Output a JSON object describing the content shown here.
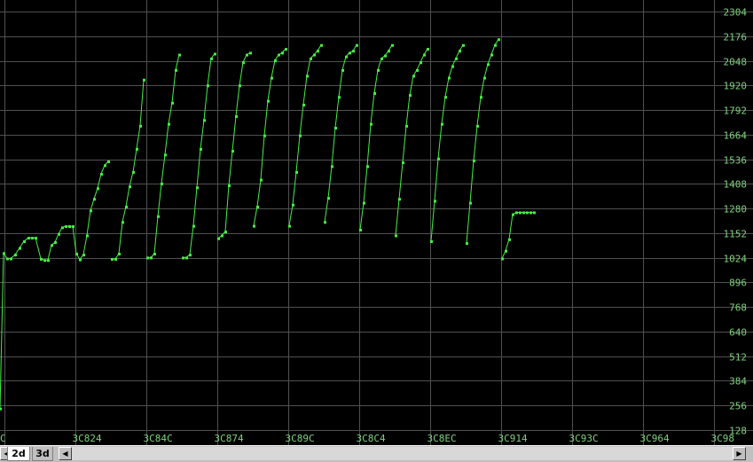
{
  "chart_data": {
    "type": "line",
    "title": "",
    "xlabel": "",
    "ylabel": "",
    "x_tick_labels": [
      "C",
      "3C824",
      "3C84C",
      "3C874",
      "3C89C",
      "3C8C4",
      "3C8EC",
      "3C914",
      "3C93C",
      "3C964",
      "3C98"
    ],
    "y_ticks": [
      128,
      256,
      384,
      512,
      640,
      768,
      896,
      1024,
      1152,
      1280,
      1408,
      1536,
      1664,
      1792,
      1920,
      2048,
      2176,
      2304
    ],
    "ylim": [
      128,
      2304
    ],
    "x_index_range": [
      0,
      849
    ],
    "grid": true,
    "line_color": "#44ee44",
    "background": "#000000",
    "series": [
      {
        "values": [
          [
            0,
            240
          ],
          [
            4,
            1048
          ],
          [
            8,
            1020
          ],
          [
            12,
            1020
          ],
          [
            17,
            1040
          ],
          [
            22,
            1075
          ],
          [
            27,
            1110
          ],
          [
            32,
            1128
          ],
          [
            36,
            1128
          ],
          [
            40,
            1128
          ],
          [
            46,
            1018
          ],
          [
            50,
            1012
          ],
          [
            54,
            1012
          ],
          [
            58,
            1090
          ],
          [
            62,
            1105
          ],
          [
            66,
            1148
          ],
          [
            70,
            1182
          ],
          [
            74,
            1188
          ],
          [
            78,
            1188
          ],
          [
            82,
            1188
          ],
          [
            86,
            1045
          ],
          [
            90,
            1015
          ],
          [
            94,
            1040
          ],
          [
            98,
            1140
          ],
          [
            102,
            1270
          ],
          [
            106,
            1330
          ],
          [
            110,
            1385
          ],
          [
            114,
            1460
          ],
          [
            118,
            1505
          ],
          [
            122,
            1525
          ],
          [
            126,
            1018
          ],
          [
            130,
            1018
          ],
          [
            134,
            1045
          ],
          [
            138,
            1210
          ],
          [
            142,
            1290
          ],
          [
            146,
            1395
          ],
          [
            150,
            1470
          ],
          [
            154,
            1590
          ],
          [
            158,
            1710
          ],
          [
            162,
            1950
          ],
          [
            166,
            1025
          ],
          [
            170,
            1025
          ],
          [
            174,
            1045
          ],
          [
            178,
            1240
          ],
          [
            182,
            1410
          ],
          [
            186,
            1560
          ],
          [
            190,
            1720
          ],
          [
            194,
            1830
          ],
          [
            198,
            2000
          ],
          [
            202,
            2080
          ],
          [
            206,
            1025
          ],
          [
            210,
            1025
          ],
          [
            214,
            1040
          ],
          [
            218,
            1190
          ],
          [
            222,
            1390
          ],
          [
            226,
            1590
          ],
          [
            230,
            1740
          ],
          [
            234,
            1920
          ],
          [
            238,
            2060
          ],
          [
            242,
            2085
          ],
          [
            246,
            1125
          ],
          [
            250,
            1140
          ],
          [
            254,
            1160
          ],
          [
            258,
            1400
          ],
          [
            262,
            1580
          ],
          [
            266,
            1760
          ],
          [
            270,
            1920
          ],
          [
            274,
            2040
          ],
          [
            278,
            2080
          ],
          [
            282,
            2090
          ],
          [
            286,
            1190
          ],
          [
            290,
            1290
          ],
          [
            294,
            1430
          ],
          [
            298,
            1660
          ],
          [
            302,
            1840
          ],
          [
            306,
            1960
          ],
          [
            310,
            2050
          ],
          [
            314,
            2080
          ],
          [
            318,
            2090
          ],
          [
            322,
            2110
          ],
          [
            326,
            1190
          ],
          [
            330,
            1300
          ],
          [
            334,
            1470
          ],
          [
            338,
            1660
          ],
          [
            342,
            1820
          ],
          [
            346,
            1970
          ],
          [
            350,
            2060
          ],
          [
            354,
            2080
          ],
          [
            358,
            2100
          ],
          [
            362,
            2130
          ],
          [
            366,
            1210
          ],
          [
            370,
            1335
          ],
          [
            374,
            1500
          ],
          [
            378,
            1700
          ],
          [
            382,
            1860
          ],
          [
            386,
            2000
          ],
          [
            390,
            2070
          ],
          [
            394,
            2090
          ],
          [
            398,
            2100
          ],
          [
            402,
            2130
          ],
          [
            406,
            1170
          ],
          [
            410,
            1310
          ],
          [
            414,
            1500
          ],
          [
            418,
            1720
          ],
          [
            422,
            1880
          ],
          [
            426,
            2000
          ],
          [
            430,
            2060
          ],
          [
            434,
            2075
          ],
          [
            438,
            2100
          ],
          [
            442,
            2130
          ],
          [
            446,
            1140
          ],
          [
            450,
            1330
          ],
          [
            454,
            1520
          ],
          [
            458,
            1710
          ],
          [
            462,
            1870
          ],
          [
            466,
            1970
          ],
          [
            470,
            2000
          ],
          [
            474,
            2040
          ],
          [
            478,
            2080
          ],
          [
            482,
            2110
          ],
          [
            486,
            1110
          ],
          [
            490,
            1320
          ],
          [
            494,
            1540
          ],
          [
            498,
            1720
          ],
          [
            502,
            1860
          ],
          [
            506,
            1960
          ],
          [
            510,
            2020
          ],
          [
            514,
            2060
          ],
          [
            518,
            2100
          ],
          [
            522,
            2130
          ],
          [
            526,
            1100
          ],
          [
            530,
            1310
          ],
          [
            534,
            1530
          ],
          [
            538,
            1710
          ],
          [
            542,
            1860
          ],
          [
            546,
            1960
          ],
          [
            550,
            2030
          ],
          [
            554,
            2080
          ],
          [
            558,
            2130
          ],
          [
            562,
            2160
          ],
          [
            566,
            1020
          ],
          [
            570,
            1060
          ],
          [
            574,
            1120
          ],
          [
            578,
            1250
          ],
          [
            582,
            1260
          ],
          [
            586,
            1260
          ],
          [
            590,
            1260
          ],
          [
            594,
            1260
          ],
          [
            598,
            1260
          ],
          [
            602,
            1260
          ]
        ]
      }
    ]
  },
  "tabs": [
    {
      "label": "2d"
    },
    {
      "label": "3d"
    }
  ],
  "icons": {
    "nav_left": "left-triangle-icon",
    "scroll_left": "left-triangle-icon",
    "scroll_right": "right-triangle-icon"
  }
}
